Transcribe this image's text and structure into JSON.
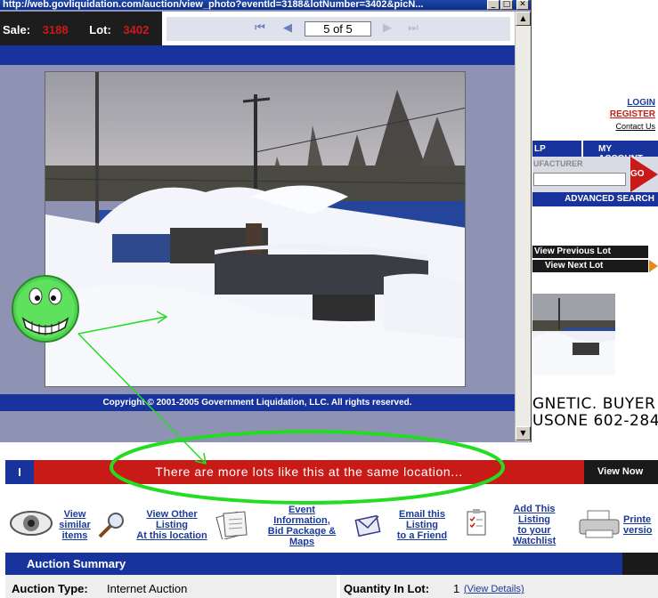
{
  "window": {
    "url": "http://web.govliquidation.com/auction/view_photo?eventId=3188&lotNumber=3402&picN..."
  },
  "sale": {
    "sale_label": "Sale:",
    "sale_value": "3188",
    "lot_label": "Lot:",
    "lot_value": "3402"
  },
  "pager": {
    "page_text": "5 of 5"
  },
  "photo": {
    "copyright": "Copyright © 2001-2005 Government Liquidation, LLC. All rights reserved."
  },
  "right_page": {
    "login": "LOGIN",
    "register": "REGISTER",
    "contact": "Contact Us",
    "nav_help": "LP",
    "nav_account": "MY ACCOUNT",
    "manufacturer_label": "UFACTURER",
    "go_button": "GO",
    "advanced_search": "ADVANCED SEARCH",
    "view_previous_lot": "View Previous Lot",
    "view_next_lot": "View Next Lot",
    "line1": "GNETIC. BUYER",
    "line2": "USONE 602-284-"
  },
  "more_lots": {
    "icon_text": "I",
    "text": "There are more lots like this at the same location...",
    "view_now": "View Now"
  },
  "actions": {
    "view_similar": [
      "View",
      "similar",
      "items"
    ],
    "view_other": [
      "View Other",
      "Listing",
      "At this location"
    ],
    "event_info": [
      "Event",
      "Information,",
      "Bid Package &",
      "Maps"
    ],
    "email_listing": [
      "Email this",
      "Listing",
      "to a Friend"
    ],
    "add_watchlist": [
      "Add This",
      "Listing",
      "to your",
      "Watchlist"
    ],
    "printer": [
      "Printe",
      "versio"
    ]
  },
  "summary": {
    "header": "Auction Summary",
    "auction_type_label": "Auction Type:",
    "auction_type_value": "Internet Auction",
    "quantity_label": "Quantity In Lot:",
    "quantity_value": "1",
    "view_details": "(View Details)"
  },
  "colors": {
    "nav_blue": "#18349c",
    "sale_red": "#d01818",
    "banner_red": "#c81b18",
    "annotation_green": "#22dd22"
  }
}
